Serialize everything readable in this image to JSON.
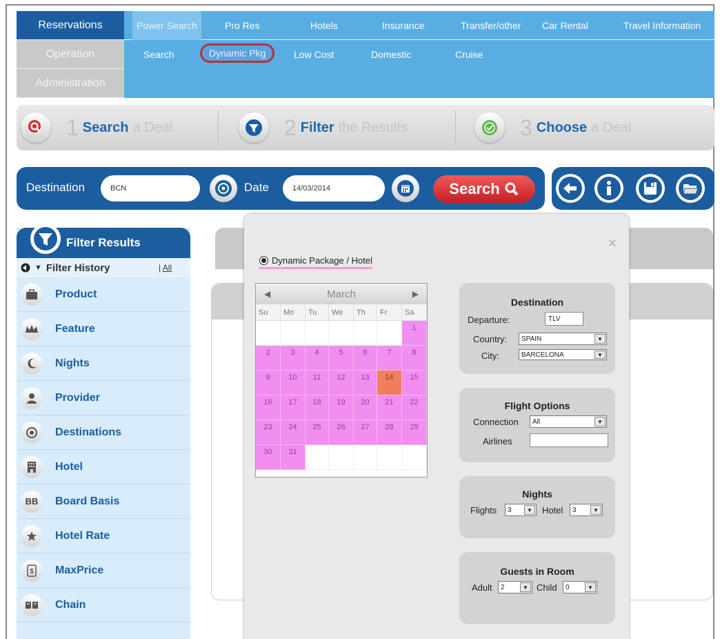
{
  "menu": {
    "left": [
      "Reservations",
      "Operation",
      "Administration"
    ],
    "row1": [
      "Power Search",
      "Pro Res",
      "Hotels",
      "Insurance",
      "Transfer/other",
      "Car Rental",
      "Travel Information"
    ],
    "row2": [
      "Search",
      "Dynamic Pkg",
      "Low Cost",
      "Domestic",
      "Cruise"
    ]
  },
  "steps": [
    {
      "num": "1",
      "bold": "Search",
      "rest": "a Deal"
    },
    {
      "num": "2",
      "bold": "Filter",
      "rest": "the Results"
    },
    {
      "num": "3",
      "bold": "Choose",
      "rest": "a Deal"
    }
  ],
  "searchbar": {
    "destination_label": "Destination",
    "destination_value": "BCN",
    "date_label": "Date",
    "date_value": "14/03/2014",
    "search_label": "Search"
  },
  "filter": {
    "title": "Filter Results",
    "history": "Filter History",
    "all": "All",
    "items": [
      "Product",
      "Feature",
      "Nights",
      "Provider",
      "Destinations",
      "Hotel",
      "Board Basis",
      "Hotel Rate",
      "MaxPrice",
      "Chain"
    ],
    "bb": "BB"
  },
  "popup": {
    "close": "×",
    "radio_label": "Dynamic Package / Hotel",
    "calendar": {
      "month": "March",
      "days": [
        "Su",
        "Mo",
        "Tu",
        "We",
        "Th",
        "Fr",
        "Sa"
      ],
      "dates": [
        "1",
        "2",
        "3",
        "4",
        "5",
        "6",
        "7",
        "8",
        "9",
        "10",
        "11",
        "12",
        "13",
        "14",
        "15",
        "16",
        "17",
        "18",
        "19",
        "20",
        "21",
        "22",
        "23",
        "24",
        "25",
        "26",
        "27",
        "28",
        "29",
        "30",
        "31"
      ],
      "selected": "14"
    },
    "destination": {
      "title": "Destination",
      "departure_label": "Departure:",
      "departure_value": "TLV",
      "country_label": "Country:",
      "country_value": "SPAIN",
      "city_label": "City:",
      "city_value": "BARCELONA"
    },
    "flight": {
      "title": "Flight Options",
      "connection_label": "Connection",
      "connection_value": "All",
      "airlines_label": "Airlines",
      "airlines_value": ""
    },
    "nights": {
      "title": "Nights",
      "flights_label": "Flights",
      "flights_value": "3",
      "hotel_label": "Hotel",
      "hotel_value": "3"
    },
    "guests": {
      "title": "Guests in Room",
      "adult_label": "Adult",
      "adult_value": "2",
      "child_label": "Child",
      "child_value": "0"
    }
  }
}
